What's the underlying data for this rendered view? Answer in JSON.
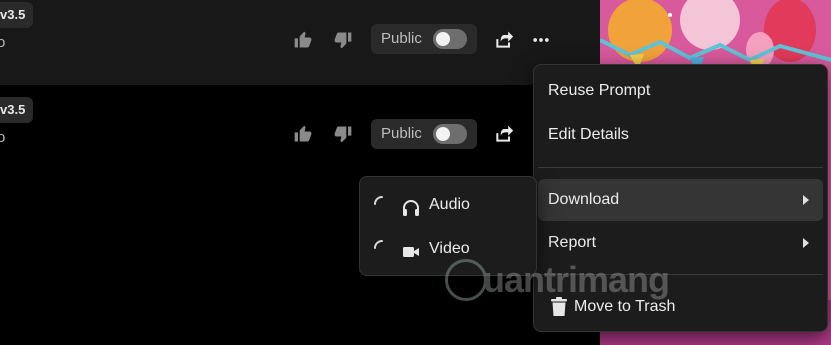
{
  "rows": [
    {
      "version": "v3.5",
      "sub": "o",
      "visibility_label": "Public"
    },
    {
      "version": "v3.5",
      "sub": "o",
      "visibility_label": "Public"
    }
  ],
  "context_menu": {
    "items": [
      {
        "label": "Reuse Prompt"
      },
      {
        "label": "Edit Details"
      },
      {
        "label": "Download"
      },
      {
        "label": "Report"
      },
      {
        "label": "Move to Trash"
      }
    ]
  },
  "download_submenu": {
    "items": [
      {
        "label": "Audio",
        "icon": "headphones-icon"
      },
      {
        "label": "Video",
        "icon": "video-camera-icon"
      }
    ]
  },
  "watermark": {
    "text": "uantrimang"
  },
  "colors": {
    "menu_bg": "#1c1c1c",
    "highlight": "#353535",
    "toggle_off": "#6e6e6e"
  }
}
